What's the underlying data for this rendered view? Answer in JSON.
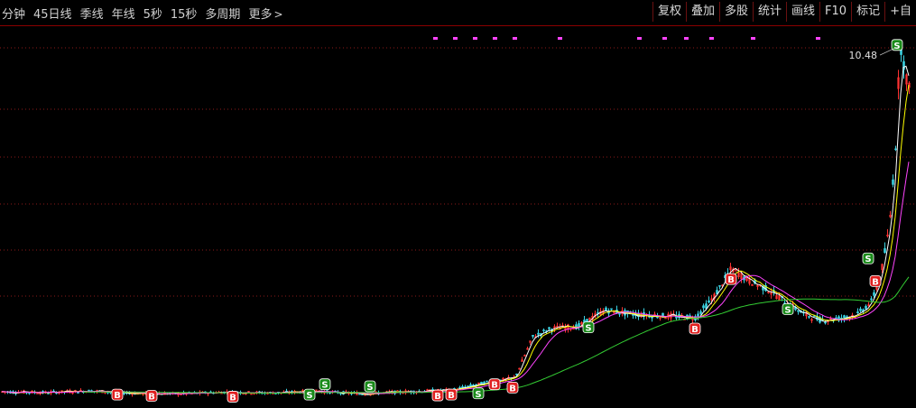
{
  "toolbar": {
    "periods": [
      "分钟",
      "45日线",
      "季线",
      "年线",
      "5秒",
      "15秒",
      "多周期",
      "更多"
    ],
    "more_chevron": ">",
    "tools": [
      "复权",
      "叠加",
      "多股",
      "统计",
      "画线",
      "F10",
      "标记",
      "+自"
    ]
  },
  "chart": {
    "price_label": "10.48",
    "colors": {
      "background": "#000000",
      "up": "#ff3232",
      "down": "#3ad1e0",
      "ma_short": "#ffffff",
      "ma_mid": "#ffff00",
      "ma_long": "#ff44ff",
      "ma_slow": "#33cc33",
      "grid": "#8b1a1a",
      "buy_marker": "#e02020",
      "sell_marker": "#1a8a1a"
    },
    "buy_label": "B",
    "sell_label": "S",
    "trend": [
      [
        0,
        2.02
      ],
      [
        50,
        2.0
      ],
      [
        100,
        2.04
      ],
      [
        150,
        1.98
      ],
      [
        200,
        1.97
      ],
      [
        250,
        2.01
      ],
      [
        300,
        1.99
      ],
      [
        350,
        2.03
      ],
      [
        400,
        1.97
      ],
      [
        450,
        2.02
      ],
      [
        500,
        2.06
      ],
      [
        540,
        2.25
      ],
      [
        570,
        2.35
      ],
      [
        590,
        3.35
      ],
      [
        610,
        3.55
      ],
      [
        640,
        3.6
      ],
      [
        670,
        4.0
      ],
      [
        700,
        3.9
      ],
      [
        740,
        3.85
      ],
      [
        770,
        3.82
      ],
      [
        790,
        4.3
      ],
      [
        810,
        5.0
      ],
      [
        830,
        4.7
      ],
      [
        850,
        4.5
      ],
      [
        870,
        4.2
      ],
      [
        890,
        3.9
      ],
      [
        910,
        3.75
      ],
      [
        930,
        3.8
      ],
      [
        950,
        3.9
      ],
      [
        965,
        4.2
      ],
      [
        975,
        4.8
      ],
      [
        985,
        6.0
      ],
      [
        992,
        8.0
      ],
      [
        997,
        10.48
      ],
      [
        1005,
        9.5
      ],
      [
        1012,
        9.0
      ]
    ],
    "buy_markers": [
      [
        130,
        1.95
      ],
      [
        168,
        1.92
      ],
      [
        258,
        1.9
      ],
      [
        485,
        1.93
      ],
      [
        500,
        1.95
      ],
      [
        548,
        2.2
      ],
      [
        568,
        2.12
      ],
      [
        770,
        3.55
      ],
      [
        970,
        4.7
      ],
      [
        810,
        4.75
      ]
    ],
    "sell_markers": [
      [
        343,
        1.95
      ],
      [
        360,
        2.2
      ],
      [
        410,
        2.15
      ],
      [
        530,
        1.98
      ],
      [
        652,
        3.58
      ],
      [
        873,
        4.02
      ],
      [
        962,
        5.25
      ],
      [
        994,
        10.42
      ]
    ]
  }
}
